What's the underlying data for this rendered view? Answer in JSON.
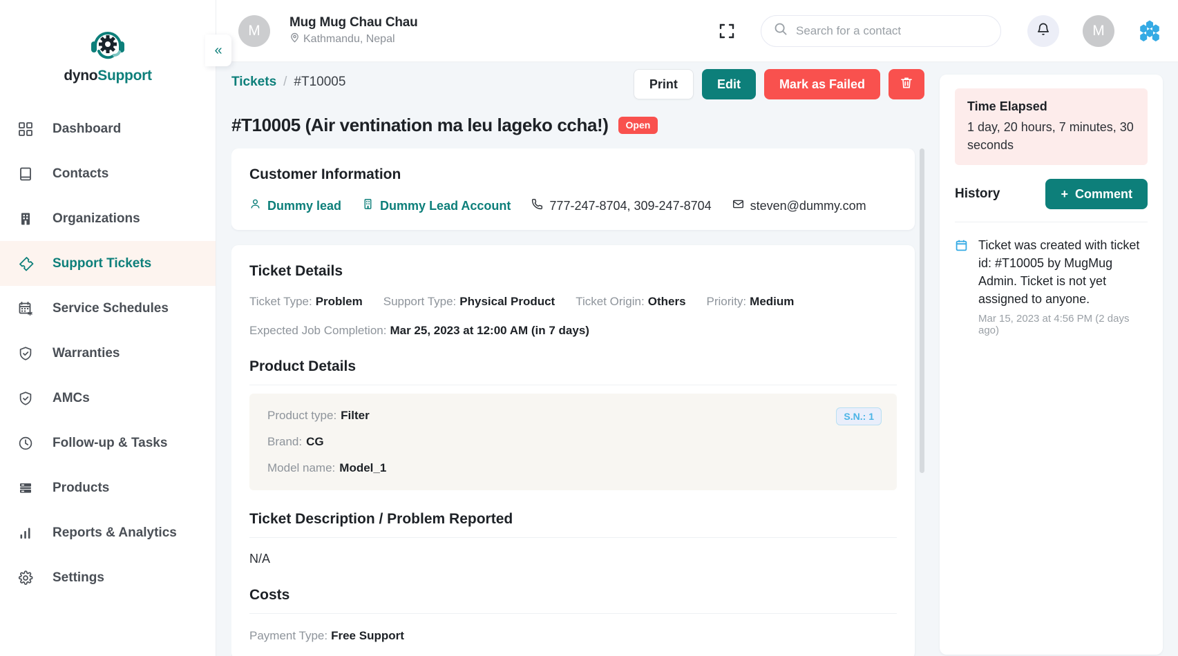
{
  "sidebar": {
    "logo": {
      "dyno": "dyno",
      "support": "Support",
      "icon": "headset-gear-logo-icon"
    },
    "collapse_label": "«",
    "items": [
      {
        "label": "Dashboard",
        "icon": "grid-icon",
        "active": false
      },
      {
        "label": "Contacts",
        "icon": "book-icon",
        "active": false
      },
      {
        "label": "Organizations",
        "icon": "building-icon",
        "active": false
      },
      {
        "label": "Support Tickets",
        "icon": "ticket-icon",
        "active": true
      },
      {
        "label": "Service Schedules",
        "icon": "calendar-star-icon",
        "active": false
      },
      {
        "label": "Warranties",
        "icon": "shield-check-icon",
        "active": false
      },
      {
        "label": "AMCs",
        "icon": "shield-check-icon",
        "active": false
      },
      {
        "label": "Follow-up & Tasks",
        "icon": "clock-icon",
        "active": false
      },
      {
        "label": "Products",
        "icon": "server-icon",
        "active": false
      },
      {
        "label": "Reports & Analytics",
        "icon": "bar-chart-icon",
        "active": false
      },
      {
        "label": "Settings",
        "icon": "gear-icon",
        "active": false
      }
    ]
  },
  "topbar": {
    "avatar_initial": "M",
    "contact_name": "Mug Mug Chau Chau",
    "contact_location": "Kathmandu, Nepal",
    "expand_icon": "fullscreen-icon",
    "search": {
      "placeholder": "Search for a contact",
      "value": "",
      "icon": "search-icon"
    },
    "bell_icon": "notification-bell-icon",
    "user_initial": "M",
    "app_switcher_icon": "hexagon-cluster-icon",
    "accent": "#0d7f7a"
  },
  "page": {
    "breadcrumb_root": "Tickets",
    "breadcrumb_sep": "/",
    "breadcrumb_current": "#T10005",
    "title": "#T10005 (Air ventination ma leu lageko ccha!)",
    "status_badge": "Open",
    "status_color": "#f9514e",
    "actions": {
      "print": "Print",
      "edit": "Edit",
      "mark_failed": "Mark as Failed",
      "delete_icon": "trash-icon"
    }
  },
  "customer": {
    "heading": "Customer Information",
    "lead_name": "Dummy lead",
    "lead_icon": "person-icon",
    "account_name": "Dummy Lead Account",
    "account_icon": "building-icon",
    "phone": "777-247-8704, 309-247-8704",
    "phone_icon": "phone-icon",
    "email": "steven@dummy.com",
    "email_icon": "envelope-icon"
  },
  "ticket_details": {
    "heading": "Ticket Details",
    "fields": [
      {
        "label": "Ticket Type:",
        "value": "Problem"
      },
      {
        "label": "Support Type:",
        "value": "Physical Product"
      },
      {
        "label": "Ticket Origin:",
        "value": "Others"
      },
      {
        "label": "Priority:",
        "value": "Medium"
      }
    ],
    "expected_label": "Expected Job Completion:",
    "expected_value": "Mar 25, 2023 at 12:00 AM (in 7 days)"
  },
  "product_details": {
    "heading": "Product Details",
    "sn_badge": "S.N.: 1",
    "rows": [
      {
        "label": "Product type:",
        "value": "Filter"
      },
      {
        "label": "Brand:",
        "value": "CG"
      },
      {
        "label": "Model name:",
        "value": "Model_1"
      }
    ]
  },
  "description": {
    "heading": "Ticket Description / Problem Reported",
    "body": "N/A"
  },
  "costs": {
    "heading": "Costs",
    "payment_label": "Payment Type:",
    "payment_value": "Free Support"
  },
  "right_panel": {
    "time_elapsed_label": "Time Elapsed",
    "time_elapsed_value": "1 day, 20 hours, 7 minutes, 30 seconds",
    "history_label": "History",
    "comment_button": "Comment",
    "comment_plus": "+",
    "history": [
      {
        "icon": "calendar-icon",
        "text": "Ticket was created with ticket id: #T10005 by MugMug Admin. Ticket is not yet assigned to anyone.",
        "time": "Mar 15, 2023 at 4:56 PM (2 days ago)"
      }
    ]
  }
}
